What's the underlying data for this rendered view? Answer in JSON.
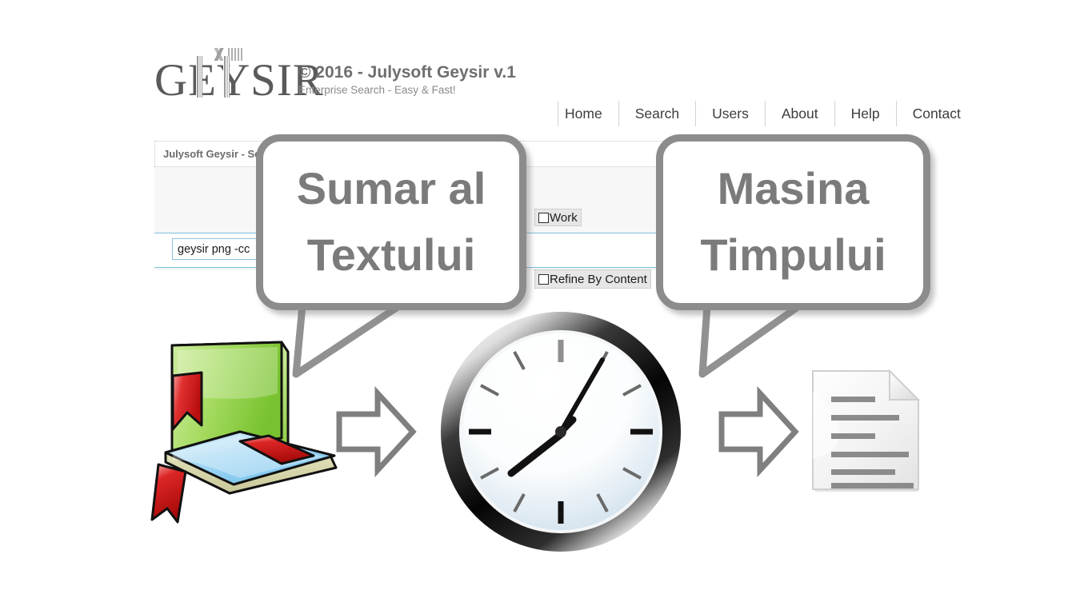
{
  "header": {
    "logo_text": "GEYSIR",
    "logo_icon": "geysir-logo",
    "brand_title": "© 2016 - Julysoft Geysir v.1",
    "brand_tagline": "Enterprise Search - Easy & Fast!"
  },
  "nav": {
    "items": [
      {
        "label": "Home"
      },
      {
        "label": "Search"
      },
      {
        "label": "Users"
      },
      {
        "label": "About"
      },
      {
        "label": "Help"
      },
      {
        "label": "Contact"
      }
    ]
  },
  "panel": {
    "title": "Julysoft Geysir - Se",
    "search": {
      "value": "geysir png -cc",
      "placeholder": ""
    },
    "checkboxes": [
      {
        "label": "Work",
        "checked": false
      },
      {
        "label": "Refine By Content",
        "checked": false
      }
    ]
  },
  "annotations": {
    "bubbles": [
      {
        "lines": [
          "Sumar al",
          "Textului"
        ]
      },
      {
        "lines": [
          "Masina",
          "Timpului"
        ]
      }
    ]
  },
  "illustration": {
    "books_icon": "books-icon",
    "arrow1_icon": "arrow-right-icon",
    "clock_icon": "clock-icon",
    "arrow2_icon": "arrow-right-icon",
    "document_icon": "document-icon",
    "clock": {
      "hour": 8,
      "minute": 7
    }
  },
  "colors": {
    "accent_blue": "#7cc0e0",
    "brand_gray": "#6e6e6e",
    "bubble_gray": "#8c8c8c",
    "book_green": "#7ec832",
    "book_blue": "#68b8e8",
    "bookmark_red": "#d42020",
    "panel_bg": "#f7f7f7"
  }
}
